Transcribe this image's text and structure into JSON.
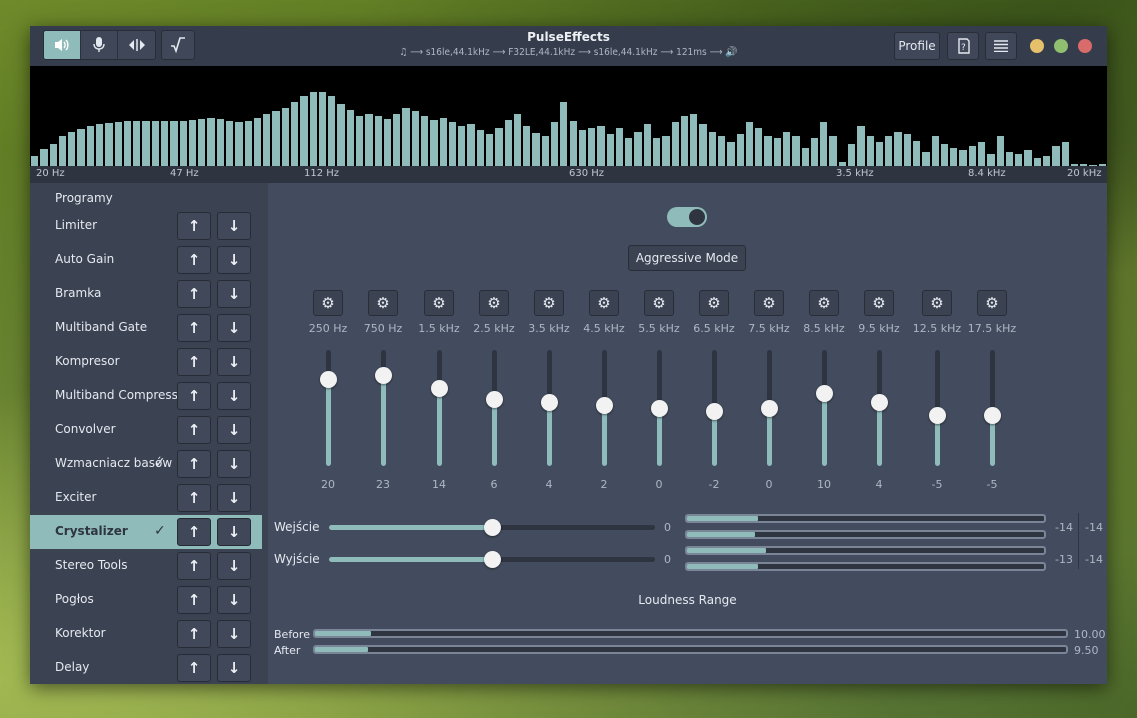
{
  "window": {
    "title": "PulseEffects",
    "pipeline": "♫ ⟶ s16le,44.1kHz ⟶ F32LE,44.1kHz ⟶ s16le,44.1kHz ⟶ 121ms ⟶ 🔊",
    "profile_label": "Profile"
  },
  "spectrum": {
    "bars": [
      10,
      17,
      22,
      30,
      34,
      37,
      40,
      42,
      43,
      44,
      45,
      45,
      45,
      45,
      45,
      45,
      45,
      46,
      47,
      48,
      47,
      45,
      44,
      45,
      48,
      52,
      55,
      58,
      64,
      70,
      74,
      74,
      70,
      62,
      56,
      50,
      52,
      50,
      47,
      52,
      58,
      55,
      50,
      46,
      48,
      44,
      40,
      42,
      36,
      32,
      38,
      46,
      52,
      40,
      33,
      30,
      44,
      64,
      45,
      36,
      38,
      40,
      32,
      38,
      28,
      34,
      42,
      28,
      30,
      44,
      50,
      52,
      42,
      34,
      30,
      24,
      32,
      44,
      38,
      30,
      28,
      34,
      30,
      18,
      28,
      44,
      30,
      4,
      22,
      40,
      30,
      24,
      30,
      34,
      32,
      25,
      14,
      30,
      22,
      18,
      16,
      20,
      24,
      12,
      30,
      14,
      12,
      16,
      8,
      10,
      20,
      24,
      2,
      2,
      1,
      2
    ],
    "labels": [
      "20 Hz",
      "47 Hz",
      "112 Hz",
      "630 Hz",
      "3.5 kHz",
      "8.4 kHz",
      "20 kHz"
    ]
  },
  "sidebar": {
    "header": "Programy",
    "items": [
      {
        "label": "Limiter",
        "checked": false,
        "selected": false
      },
      {
        "label": "Auto Gain",
        "checked": false,
        "selected": false
      },
      {
        "label": "Bramka",
        "checked": false,
        "selected": false
      },
      {
        "label": "Multiband Gate",
        "checked": false,
        "selected": false
      },
      {
        "label": "Kompresor",
        "checked": false,
        "selected": false
      },
      {
        "label": "Multiband Compressor",
        "checked": false,
        "selected": false
      },
      {
        "label": "Convolver",
        "checked": false,
        "selected": false
      },
      {
        "label": "Wzmacniacz basów",
        "checked": true,
        "selected": false
      },
      {
        "label": "Exciter",
        "checked": false,
        "selected": false
      },
      {
        "label": "Crystalizer",
        "checked": true,
        "selected": true
      },
      {
        "label": "Stereo Tools",
        "checked": false,
        "selected": false
      },
      {
        "label": "Pogłos",
        "checked": false,
        "selected": false
      },
      {
        "label": "Korektor",
        "checked": false,
        "selected": false
      },
      {
        "label": "Delay",
        "checked": false,
        "selected": false
      }
    ],
    "up_icon": "arrow-up-icon",
    "down_icon": "arrow-down-icon"
  },
  "crystalizer": {
    "enabled": true,
    "aggressive_label": "Aggressive Mode",
    "band_range": [
      -40,
      40
    ],
    "bands": [
      {
        "freq": "250 Hz",
        "value": 20
      },
      {
        "freq": "750 Hz",
        "value": 23
      },
      {
        "freq": "1.5 kHz",
        "value": 14
      },
      {
        "freq": "2.5 kHz",
        "value": 6
      },
      {
        "freq": "3.5 kHz",
        "value": 4
      },
      {
        "freq": "4.5 kHz",
        "value": 2
      },
      {
        "freq": "5.5 kHz",
        "value": 0
      },
      {
        "freq": "6.5 kHz",
        "value": -2
      },
      {
        "freq": "7.5 kHz",
        "value": 0
      },
      {
        "freq": "8.5 kHz",
        "value": 10
      },
      {
        "freq": "9.5 kHz",
        "value": 4
      },
      {
        "freq": "12.5 kHz",
        "value": -5
      },
      {
        "freq": "17.5 kHz",
        "value": -5
      }
    ],
    "input": {
      "label": "Wejście",
      "value": "0",
      "fraction": 0.5,
      "meter_l": 0.2,
      "meter_r": 0.19,
      "val_l": "-14",
      "val_r": "-14"
    },
    "output": {
      "label": "Wyjście",
      "value": "0",
      "fraction": 0.5,
      "meter_l": 0.22,
      "meter_r": 0.2,
      "val_l": "-13",
      "val_r": "-14"
    },
    "loudness": {
      "title": "Loudness Range",
      "before": {
        "label": "Before",
        "value": "10.00",
        "fraction": 0.075
      },
      "after": {
        "label": "After",
        "value": "9.50",
        "fraction": 0.07
      }
    }
  },
  "colors": {
    "accent": "#8fbcbb",
    "close": "#d96b6b",
    "max": "#8fbf6f",
    "min": "#e6c16c"
  }
}
